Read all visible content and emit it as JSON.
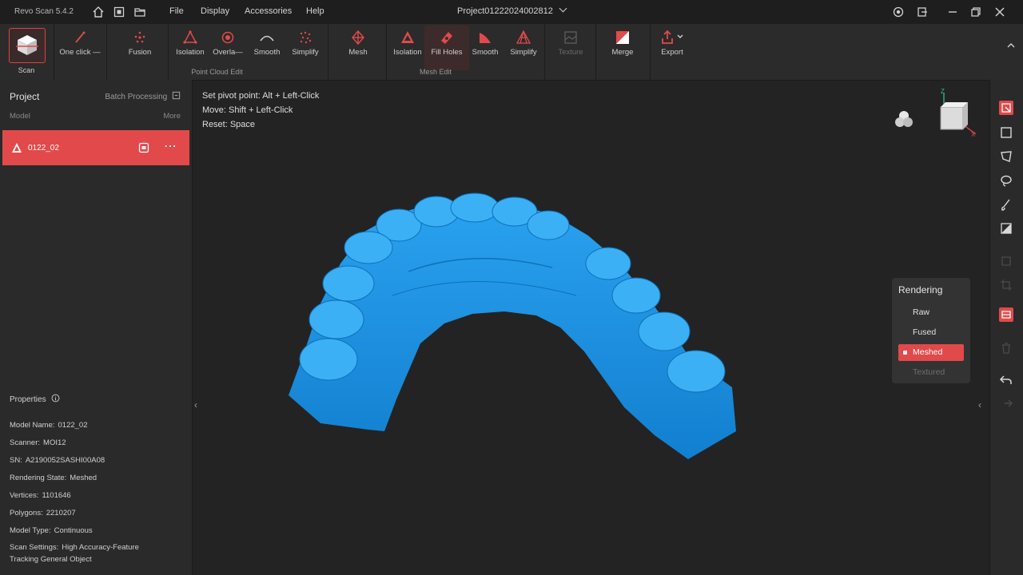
{
  "app": {
    "title": "Revo Scan 5.4.2",
    "project_title": "Project01222024002812"
  },
  "menu": [
    "File",
    "Display",
    "Accessories",
    "Help"
  ],
  "toolbar": {
    "scan_label": "Scan",
    "point_cloud_tools": [
      "One click —",
      "Fusion",
      "Isolation",
      "Overla—",
      "Smooth",
      "Simplify"
    ],
    "point_cloud_group": "Point Cloud Edit",
    "mesh_tools": [
      "Mesh",
      "Isolation",
      "Fill Holes",
      "Smooth",
      "Simplify"
    ],
    "mesh_group": "Mesh Edit",
    "texture_label": "Texture",
    "merge_label": "Merge",
    "export_label": "Export"
  },
  "project_panel": {
    "title": "Project",
    "batch": "Batch Processing",
    "col_model": "Model",
    "col_more": "More",
    "model_name": "0122_02"
  },
  "properties": {
    "title": "Properties",
    "items": [
      {
        "label": "Model Name:",
        "value": "0122_02"
      },
      {
        "label": "Scanner:",
        "value": "MOI12"
      },
      {
        "label": "SN:",
        "value": "A2190052SASHI00A08"
      },
      {
        "label": "Rendering State:",
        "value": "Meshed"
      },
      {
        "label": "Vertices:",
        "value": "1101646"
      },
      {
        "label": "Polygons:",
        "value": "2210207"
      },
      {
        "label": "Model Type:",
        "value": "Continuous"
      },
      {
        "label": "Scan Settings:",
        "value": "High Accuracy-Feature"
      }
    ],
    "scan_settings_line2": "Tracking General Object"
  },
  "viewport": {
    "hints": [
      "Set pivot point: Alt + Left-Click",
      "Move: Shift + Left-Click",
      "Reset: Space"
    ],
    "model_color": "#1b8fe0"
  },
  "rendering": {
    "title": "Rendering",
    "options": [
      "Raw",
      "Fused",
      "Meshed",
      "Textured"
    ],
    "selected": "Meshed"
  },
  "colors": {
    "accent": "#e2494a",
    "background": "#232323"
  }
}
